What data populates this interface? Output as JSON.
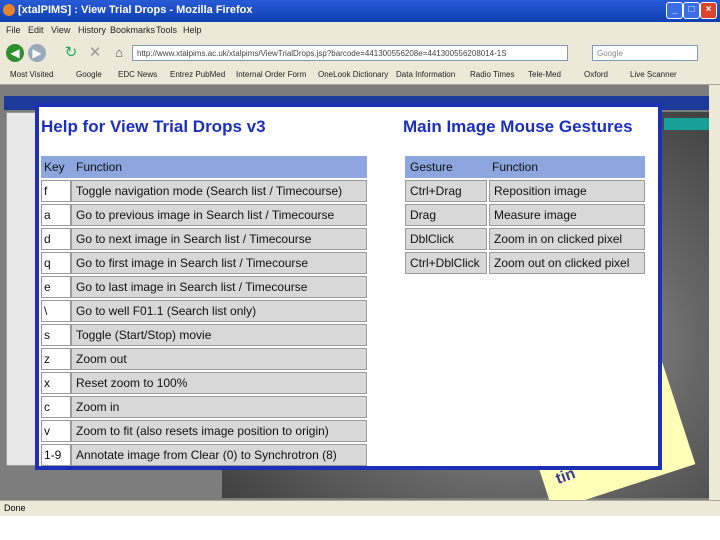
{
  "browser": {
    "title": "[xtalPIMS] : View Trial Drops - Mozilla Firefox",
    "menu": [
      "File",
      "Edit",
      "View",
      "History",
      "Bookmarks",
      "Tools",
      "Help"
    ],
    "url": "http://www.xtalpims.ac.uk/xtalpims/ViewTrialDrops.jsp?barcode=441300556208e=441300556208014-1S",
    "search_placeholder": "Google",
    "bookmarks": [
      "Most Visited",
      "Google",
      "EDC News",
      "Entrez PubMed",
      "Internal Order Form",
      "OneLook Dictionary",
      "Data Information",
      "Radio Times",
      "Tele-Med",
      "Oxford",
      "Live Scanner"
    ],
    "status": "Done"
  },
  "help": {
    "title_left": "Help for View Trial Drops v3",
    "title_right": "Main Image Mouse Gestures",
    "key_header": "Key",
    "function_header": "Function",
    "keys": [
      {
        "key": "f",
        "function": "Toggle navigation mode (Search list / Timecourse)"
      },
      {
        "key": "a",
        "function": "Go to previous image in Search list / Timecourse"
      },
      {
        "key": "d",
        "function": "Go to next image in Search list / Timecourse"
      },
      {
        "key": "q",
        "function": "Go to first image in Search list / Timecourse"
      },
      {
        "key": "e",
        "function": "Go to last image in Search list / Timecourse"
      },
      {
        "key": "\\",
        "function": "Go to well F01.1 (Search list only)"
      },
      {
        "key": "s",
        "function": "Toggle (Start/Stop) movie"
      },
      {
        "key": "z",
        "function": "Zoom out"
      },
      {
        "key": "x",
        "function": "Reset zoom to 100%"
      },
      {
        "key": "c",
        "function": "Zoom in"
      },
      {
        "key": "v",
        "function": "Zoom to fit (also resets image position to origin)"
      },
      {
        "key": "1-9",
        "function": "Annotate image from Clear (0) to Synchrotron (8)"
      }
    ],
    "gesture_header": "Gesture",
    "gesture_function_header": "Function",
    "gestures": [
      {
        "gesture": "Ctrl+Drag",
        "function": "Reposition image"
      },
      {
        "gesture": "Drag",
        "function": "Measure image"
      },
      {
        "gesture": "DblClick",
        "function": "Zoom in on clicked pixel"
      },
      {
        "gesture": "Ctrl+DblClick",
        "function": "Zoom out on clicked pixel"
      }
    ]
  },
  "colors": {
    "dialog_border": "#1c2fb5",
    "header_bg": "#8da6e0",
    "title": "#1a2fc0"
  }
}
